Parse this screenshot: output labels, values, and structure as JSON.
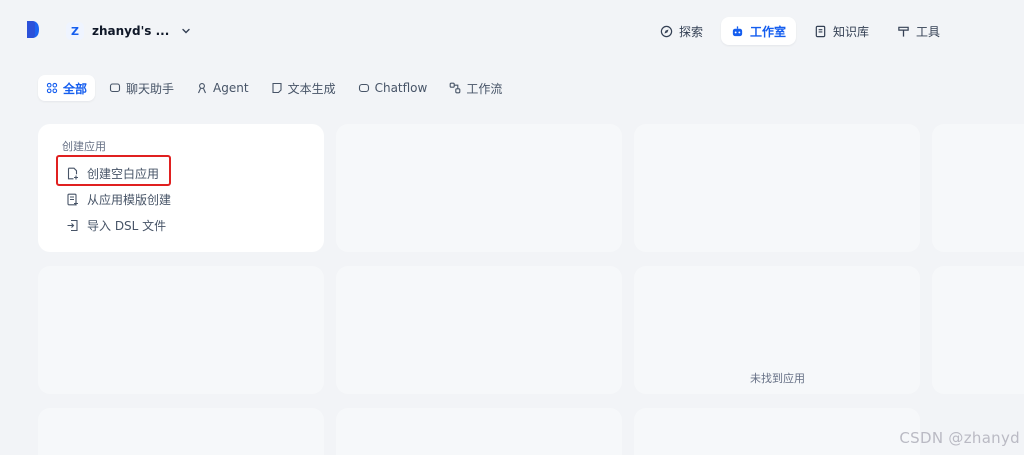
{
  "workspace": {
    "initial": "Z",
    "name": "zhanyd's ..."
  },
  "nav": [
    {
      "label": "探索",
      "icon": "compass-icon"
    },
    {
      "label": "工作室",
      "icon": "robot-icon",
      "active": true
    },
    {
      "label": "知识库",
      "icon": "book-icon"
    },
    {
      "label": "工具",
      "icon": "hammer-icon"
    }
  ],
  "tabs": [
    {
      "label": "全部",
      "icon": "grid-icon",
      "active": true
    },
    {
      "label": "聊天助手",
      "icon": "chat-icon"
    },
    {
      "label": "Agent",
      "icon": "agent-icon"
    },
    {
      "label": "文本生成",
      "icon": "document-icon"
    },
    {
      "label": "Chatflow",
      "icon": "chatflow-icon"
    },
    {
      "label": "工作流",
      "icon": "workflow-icon"
    }
  ],
  "create": {
    "title": "创建应用",
    "items": [
      {
        "label": "创建空白应用",
        "icon": "file-plus-icon"
      },
      {
        "label": "从应用模版创建",
        "icon": "template-icon"
      },
      {
        "label": "导入 DSL 文件",
        "icon": "import-icon"
      }
    ]
  },
  "empty_state": "未找到应用",
  "watermark": "CSDN @zhanyd",
  "colors": {
    "accent": "#155eef",
    "background": "#f2f4f7",
    "highlight": "#e02020"
  }
}
